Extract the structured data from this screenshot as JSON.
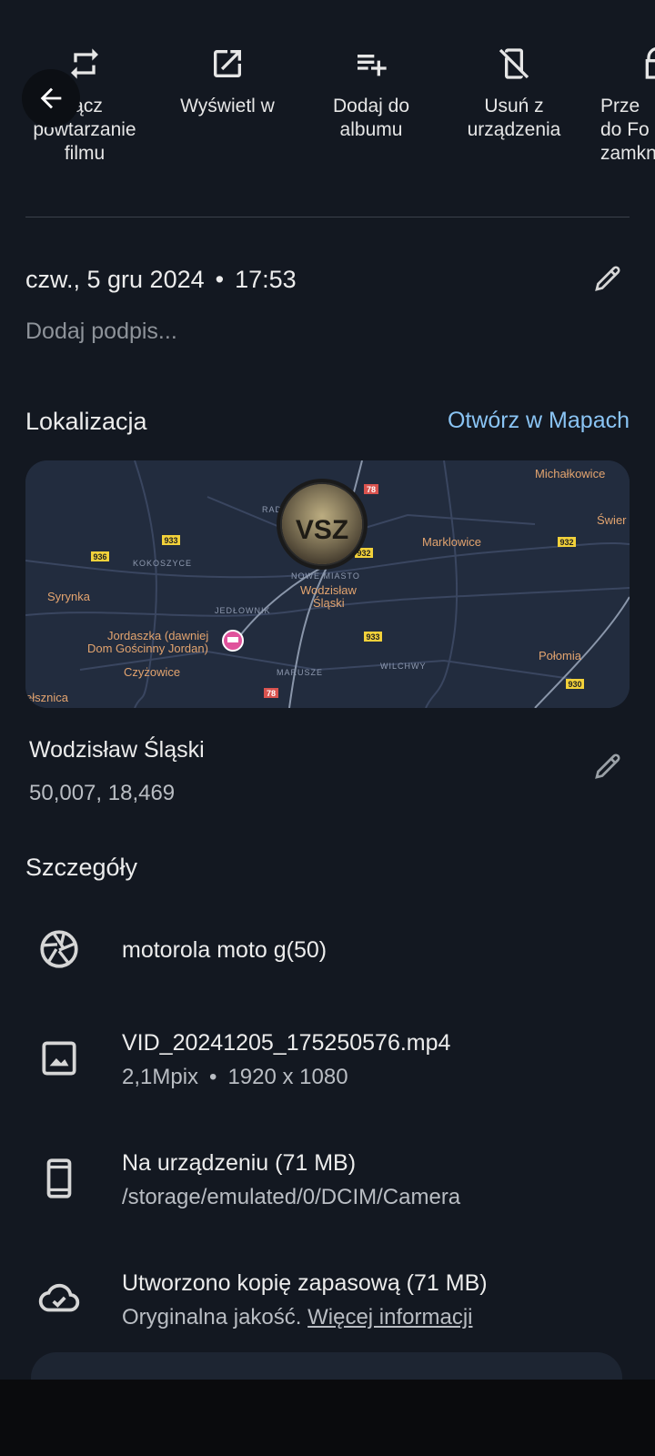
{
  "actions": [
    {
      "label": "…łącz powtarzanie filmu",
      "display": "rącz\npowtarzanie\nfilmu",
      "icon": "repeat-icon"
    },
    {
      "label": "Wyświetl w",
      "display": "Wyświetl w",
      "icon": "open-in-new-icon"
    },
    {
      "label": "Dodaj do albumu",
      "display": "Dodaj do\nalbumu",
      "icon": "playlist-add-icon"
    },
    {
      "label": "Usuń z urządzenia",
      "display": "Usuń z\nurządzenia",
      "icon": "mobile-off-icon"
    },
    {
      "label": "Prze… do Fo… zamkn…",
      "display": "Prze\ndo Fo\nzamkn",
      "icon": "lock-folder-icon"
    }
  ],
  "back": {
    "icon": "arrow-back-icon"
  },
  "info": {
    "date": "czw., 5 gru 2024",
    "time": "17:53",
    "caption_placeholder": "Dodaj podpis...",
    "edit_icon": "pencil-icon"
  },
  "location": {
    "title": "Lokalizacja",
    "open_maps": "Otwórz w Mapach",
    "place": "Wodzisław Śląski",
    "coords": "50,007, 18,469",
    "map": {
      "labels": {
        "michalkowice": "Michałkowice",
        "swier": "Świer",
        "marklowice": "Marklowice",
        "syrynka": "Syrynka",
        "wodzislaw": "Wodzisław",
        "slaski": "Śląski",
        "kokoszyce": "KOKOSZYCE",
        "jedlownik": "JEDŁOWNIK",
        "jordaszka1": "Jordaszka (dawniej",
        "jordaszka2": "Dom Gościnny Jordan)",
        "czyzowice": "Czyżowice",
        "marusze": "MARUSZE",
        "wilchwy": "WILCHWY",
        "polomia": "Połomia",
        "nowe_miasto": "NOWE MIASTO",
        "radlin": "RAD",
        "pelsznica": "ełsznica",
        "thumb_text": "VSZ"
      },
      "roads": [
        "78",
        "933",
        "936",
        "932",
        "932",
        "933",
        "78",
        "930"
      ],
      "accent_color": "#e3a46f",
      "hotel_pin_color": "#e0529c"
    }
  },
  "details": {
    "title": "Szczegóły",
    "camera": {
      "icon": "camera-shutter-icon",
      "text": "motorola moto g(50)"
    },
    "file": {
      "icon": "image-icon",
      "name": "VID_20241205_175250576.mp4",
      "mpix": "2,1Mpix",
      "resolution": "1920 x 1080"
    },
    "storage": {
      "icon": "phone-icon",
      "title": "Na urządzeniu (71 MB)",
      "path": "/storage/emulated/0/DCIM/Camera"
    },
    "backup": {
      "icon": "cloud-done-icon",
      "title": "Utworzono kopię zapasową (71 MB)",
      "quality": "Oryginalna jakość.",
      "more": "Więcej informacji"
    }
  }
}
